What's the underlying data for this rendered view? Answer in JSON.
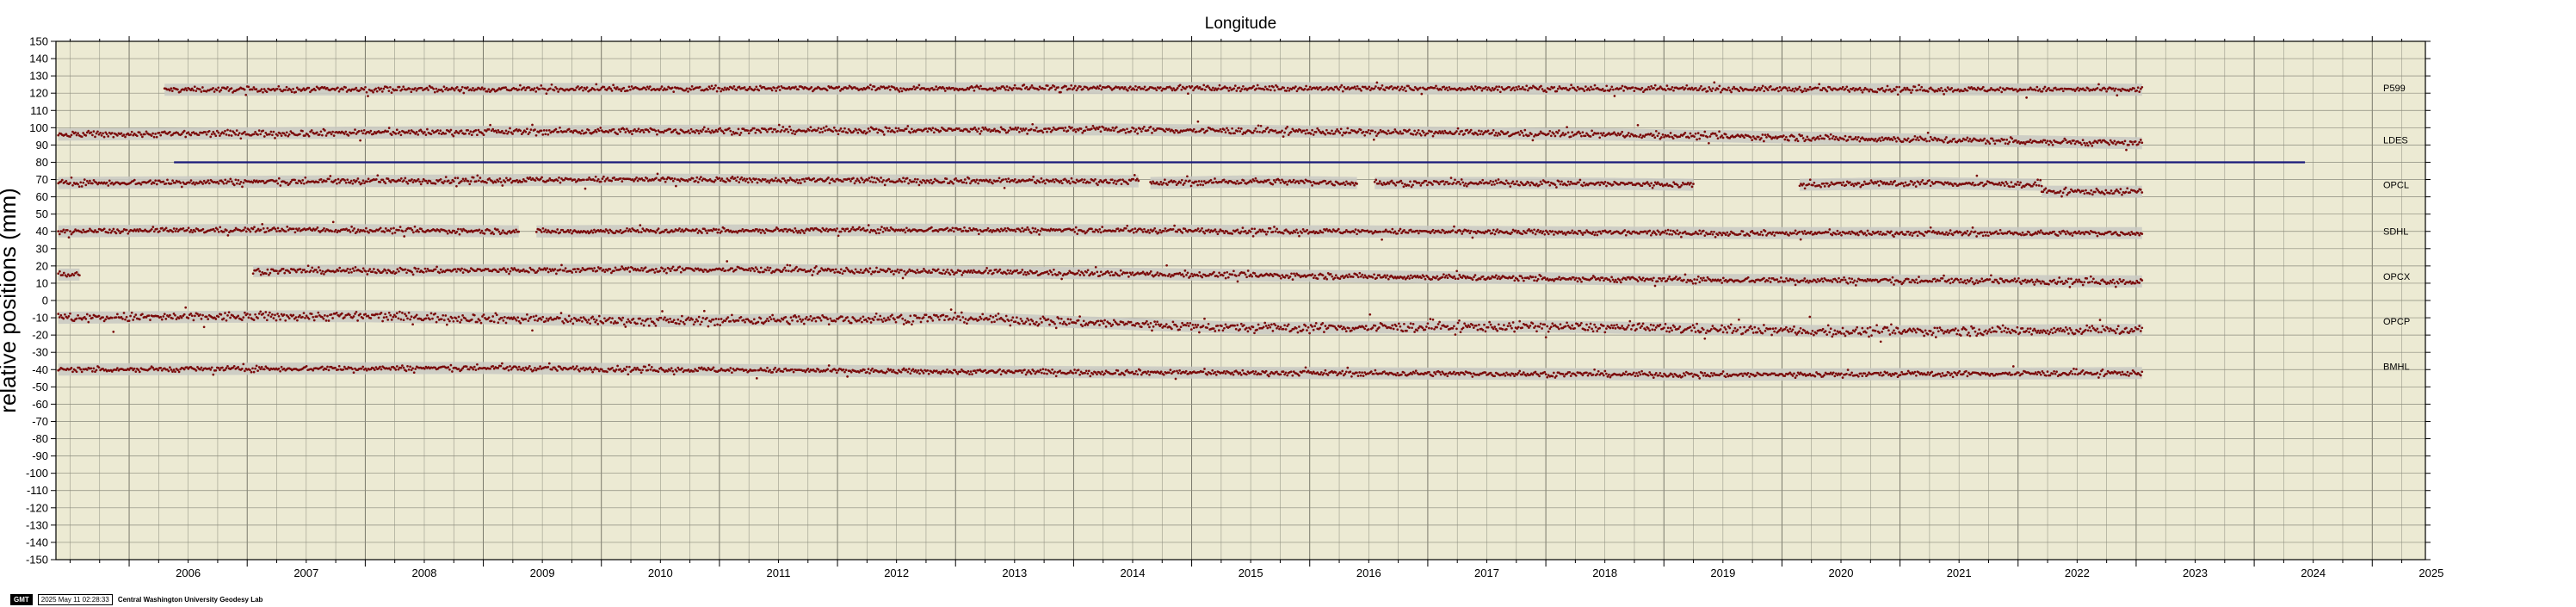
{
  "chart_data": {
    "type": "scatter",
    "title": "Longitude",
    "ylabel": "relative positions (mm)",
    "xlabel": "",
    "xlim": [
      2005.38,
      2025.45
    ],
    "ylim": [
      -150,
      150
    ],
    "x_ticks": [
      "2006",
      "2007",
      "2008",
      "2009",
      "2010",
      "2011",
      "2012",
      "2013",
      "2014",
      "2015",
      "2016",
      "2017",
      "2018",
      "2019",
      "2020",
      "2021",
      "2022",
      "2023",
      "2024",
      "2025"
    ],
    "y_ticks": [
      150,
      140,
      130,
      120,
      110,
      100,
      90,
      80,
      70,
      60,
      50,
      40,
      30,
      20,
      10,
      0,
      -10,
      -20,
      -30,
      -40,
      -50,
      -60,
      -70,
      -80,
      -90,
      -100,
      -110,
      -120,
      -130,
      -140,
      -150
    ],
    "grid": true,
    "background_color": "#ecead3",
    "point_color": "#7a0a0a",
    "uncertainty_band_color": "#c9c9c2",
    "reference_line": {
      "y": 80,
      "x_start": 2006.38,
      "x_end": 2024.43,
      "color": "#1a1a7a"
    },
    "series": [
      {
        "name": "P599",
        "label_y": 123,
        "segments": [
          {
            "x": [
              2006.3,
              2023.05
            ],
            "y": [
              122,
              123,
              122
            ]
          }
        ],
        "scatter": 1.8
      },
      {
        "name": "LDES",
        "label_y": 93,
        "segments": [
          {
            "x": [
              2005.4,
              2023.05
            ],
            "y": [
              96,
              98,
              99,
              96,
              91
            ]
          }
        ],
        "scatter": 2.2
      },
      {
        "name": "OPCL",
        "label_y": 67,
        "segments": [
          {
            "x": [
              2005.4,
              2014.55
            ],
            "y": [
              68,
              70,
              69
            ]
          },
          {
            "x": [
              2014.65,
              2016.4
            ],
            "y": [
              68,
              69,
              68
            ]
          },
          {
            "x": [
              2016.55,
              2019.25
            ],
            "y": [
              68,
              68,
              67
            ]
          },
          {
            "x": [
              2020.15,
              2022.2
            ],
            "y": [
              67,
              68,
              67
            ]
          },
          {
            "x": [
              2022.2,
              2023.05
            ],
            "y": [
              63,
              63
            ]
          }
        ],
        "scatter": 2.0
      },
      {
        "name": "SDHL",
        "label_y": 40,
        "segments": [
          {
            "x": [
              2005.4,
              2009.3
            ],
            "y": [
              40,
              41,
              40
            ]
          },
          {
            "x": [
              2009.45,
              2023.05
            ],
            "y": [
              40,
              41,
              40,
              39,
              39
            ]
          }
        ],
        "scatter": 1.8
      },
      {
        "name": "OPCX",
        "label_y": 14,
        "segments": [
          {
            "x": [
              2005.4,
              2005.58
            ],
            "y": [
              15,
              15
            ]
          },
          {
            "x": [
              2007.05,
              2023.05
            ],
            "y": [
              17,
              18,
              15,
              12,
              11
            ]
          }
        ],
        "scatter": 2.0
      },
      {
        "name": "OPCP",
        "label_y": -12,
        "segments": [
          {
            "x": [
              2005.4,
              2023.05
            ],
            "y": [
              -10,
              -9,
              -12,
              -10,
              -16,
              -15,
              -18,
              -17
            ]
          }
        ],
        "scatter": 3.2
      },
      {
        "name": "BMHL",
        "label_y": -38,
        "segments": [
          {
            "x": [
              2005.4,
              2023.05
            ],
            "y": [
              -40,
              -39,
              -41,
              -42,
              -43,
              -42
            ]
          }
        ],
        "scatter": 1.8
      }
    ]
  },
  "footer": {
    "logo_text": "GMT",
    "timestamp": "2025 May 11 02:28:33",
    "lab": "Central Washington University Geodesy Lab"
  }
}
